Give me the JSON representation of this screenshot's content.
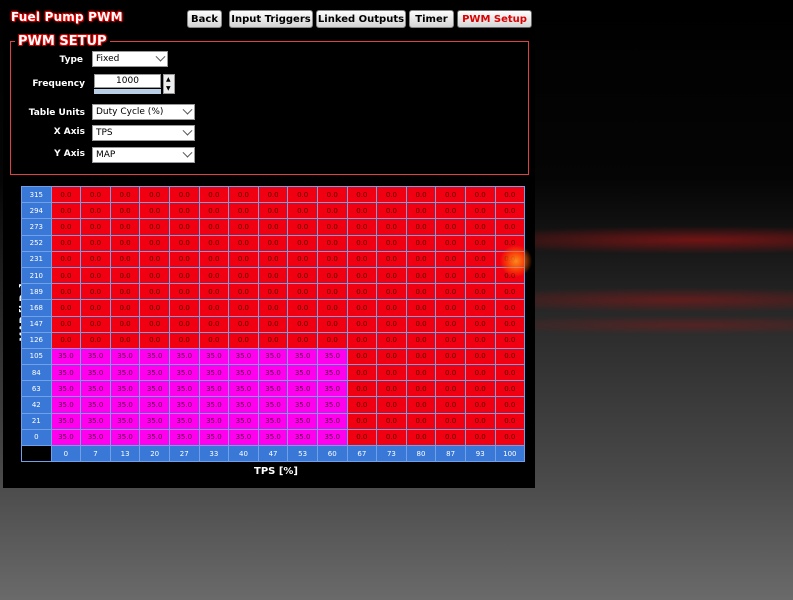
{
  "app": {
    "title": "Fuel Pump PWM"
  },
  "nav": {
    "back": "Back",
    "input_triggers": "Input Triggers",
    "linked_outputs": "Linked Outputs",
    "timer": "Timer",
    "pwm_setup": "PWM Setup",
    "active": "pwm_setup"
  },
  "setup": {
    "title": "PWM SETUP",
    "type_label": "Type",
    "type_value": "Fixed",
    "frequency_label": "Frequency",
    "frequency_value": "1000",
    "table_units_label": "Table Units",
    "table_units_value": "Duty Cycle (%)",
    "x_axis_label": "X Axis",
    "x_axis_value": "TPS",
    "y_axis_label": "Y Axis",
    "y_axis_value": "MAP"
  },
  "table": {
    "y_axis_title": "MAP [kPa]",
    "x_axis_title": "TPS [%]",
    "y_values": [
      "315",
      "294",
      "273",
      "252",
      "231",
      "210",
      "189",
      "168",
      "147",
      "126",
      "105",
      "84",
      "63",
      "42",
      "21",
      "0"
    ],
    "x_values": [
      "0",
      "7",
      "13",
      "20",
      "27",
      "33",
      "40",
      "47",
      "53",
      "60",
      "67",
      "73",
      "80",
      "87",
      "93",
      "100"
    ],
    "rows": [
      [
        "0.0",
        "0.0",
        "0.0",
        "0.0",
        "0.0",
        "0.0",
        "0.0",
        "0.0",
        "0.0",
        "0.0",
        "0.0",
        "0.0",
        "0.0",
        "0.0",
        "0.0",
        "0.0"
      ],
      [
        "0.0",
        "0.0",
        "0.0",
        "0.0",
        "0.0",
        "0.0",
        "0.0",
        "0.0",
        "0.0",
        "0.0",
        "0.0",
        "0.0",
        "0.0",
        "0.0",
        "0.0",
        "0.0"
      ],
      [
        "0.0",
        "0.0",
        "0.0",
        "0.0",
        "0.0",
        "0.0",
        "0.0",
        "0.0",
        "0.0",
        "0.0",
        "0.0",
        "0.0",
        "0.0",
        "0.0",
        "0.0",
        "0.0"
      ],
      [
        "0.0",
        "0.0",
        "0.0",
        "0.0",
        "0.0",
        "0.0",
        "0.0",
        "0.0",
        "0.0",
        "0.0",
        "0.0",
        "0.0",
        "0.0",
        "0.0",
        "0.0",
        "0.0"
      ],
      [
        "0.0",
        "0.0",
        "0.0",
        "0.0",
        "0.0",
        "0.0",
        "0.0",
        "0.0",
        "0.0",
        "0.0",
        "0.0",
        "0.0",
        "0.0",
        "0.0",
        "0.0",
        "0.0"
      ],
      [
        "0.0",
        "0.0",
        "0.0",
        "0.0",
        "0.0",
        "0.0",
        "0.0",
        "0.0",
        "0.0",
        "0.0",
        "0.0",
        "0.0",
        "0.0",
        "0.0",
        "0.0",
        "0.0"
      ],
      [
        "0.0",
        "0.0",
        "0.0",
        "0.0",
        "0.0",
        "0.0",
        "0.0",
        "0.0",
        "0.0",
        "0.0",
        "0.0",
        "0.0",
        "0.0",
        "0.0",
        "0.0",
        "0.0"
      ],
      [
        "0.0",
        "0.0",
        "0.0",
        "0.0",
        "0.0",
        "0.0",
        "0.0",
        "0.0",
        "0.0",
        "0.0",
        "0.0",
        "0.0",
        "0.0",
        "0.0",
        "0.0",
        "0.0"
      ],
      [
        "0.0",
        "0.0",
        "0.0",
        "0.0",
        "0.0",
        "0.0",
        "0.0",
        "0.0",
        "0.0",
        "0.0",
        "0.0",
        "0.0",
        "0.0",
        "0.0",
        "0.0",
        "0.0"
      ],
      [
        "0.0",
        "0.0",
        "0.0",
        "0.0",
        "0.0",
        "0.0",
        "0.0",
        "0.0",
        "0.0",
        "0.0",
        "0.0",
        "0.0",
        "0.0",
        "0.0",
        "0.0",
        "0.0"
      ],
      [
        "35.0",
        "35.0",
        "35.0",
        "35.0",
        "35.0",
        "35.0",
        "35.0",
        "35.0",
        "35.0",
        "35.0",
        "0.0",
        "0.0",
        "0.0",
        "0.0",
        "0.0",
        "0.0"
      ],
      [
        "35.0",
        "35.0",
        "35.0",
        "35.0",
        "35.0",
        "35.0",
        "35.0",
        "35.0",
        "35.0",
        "35.0",
        "0.0",
        "0.0",
        "0.0",
        "0.0",
        "0.0",
        "0.0"
      ],
      [
        "35.0",
        "35.0",
        "35.0",
        "35.0",
        "35.0",
        "35.0",
        "35.0",
        "35.0",
        "35.0",
        "35.0",
        "0.0",
        "0.0",
        "0.0",
        "0.0",
        "0.0",
        "0.0"
      ],
      [
        "35.0",
        "35.0",
        "35.0",
        "35.0",
        "35.0",
        "35.0",
        "35.0",
        "35.0",
        "35.0",
        "35.0",
        "0.0",
        "0.0",
        "0.0",
        "0.0",
        "0.0",
        "0.0"
      ],
      [
        "35.0",
        "35.0",
        "35.0",
        "35.0",
        "35.0",
        "35.0",
        "35.0",
        "35.0",
        "35.0",
        "35.0",
        "0.0",
        "0.0",
        "0.0",
        "0.0",
        "0.0",
        "0.0"
      ],
      [
        "35.0",
        "35.0",
        "35.0",
        "35.0",
        "35.0",
        "35.0",
        "35.0",
        "35.0",
        "35.0",
        "35.0",
        "0.0",
        "0.0",
        "0.0",
        "0.0",
        "0.0",
        "0.0"
      ]
    ]
  },
  "colors": {
    "zero_cell": "#f00010",
    "nonzero_cell": "#ff00ee",
    "axis_cell": "#3a78d8",
    "accent": "#e04040"
  }
}
